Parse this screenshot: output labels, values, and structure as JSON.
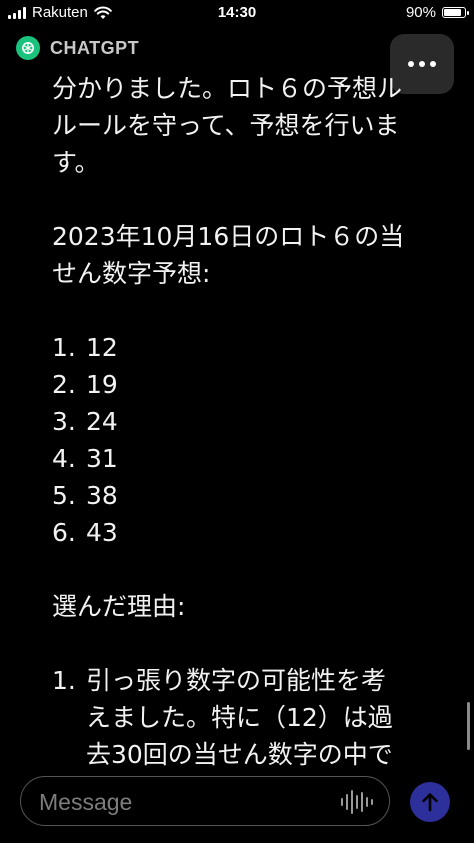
{
  "status_bar": {
    "carrier": "Rakuten",
    "time": "14:30",
    "battery": "90%",
    "battery_level": 0.9
  },
  "header": {
    "app_name": "CHATGPT",
    "logo_icon": "openai-logo-icon",
    "menu_icon": "more-horizontal-icon"
  },
  "message": {
    "intro_lines": [
      "分かりました。ロト６の予想ル",
      "ルールを守って、予想を行いま",
      "す。"
    ],
    "heading_lines": [
      "2023年10月16日のロト６の当",
      "せん数字予想:"
    ],
    "numbers": [
      {
        "index": "1.",
        "value": "12"
      },
      {
        "index": "2.",
        "value": "19"
      },
      {
        "index": "3.",
        "value": "24"
      },
      {
        "index": "4.",
        "value": "31"
      },
      {
        "index": "5.",
        "value": "38"
      },
      {
        "index": "6.",
        "value": "43"
      }
    ],
    "reason_heading": "選んだ理由:",
    "reason_index": "1.",
    "reason_lines": [
      "引っ張り数字の可能性を考",
      "えました。特に（12）は過",
      "去30回の当せん数字の中で"
    ]
  },
  "composer": {
    "placeholder": "Message",
    "voice_icon": "voice-waveform-icon",
    "send_icon": "arrow-up-icon"
  },
  "colors": {
    "background": "#000000",
    "logo": "#19c37d",
    "send_button": "#2d2f9a"
  }
}
